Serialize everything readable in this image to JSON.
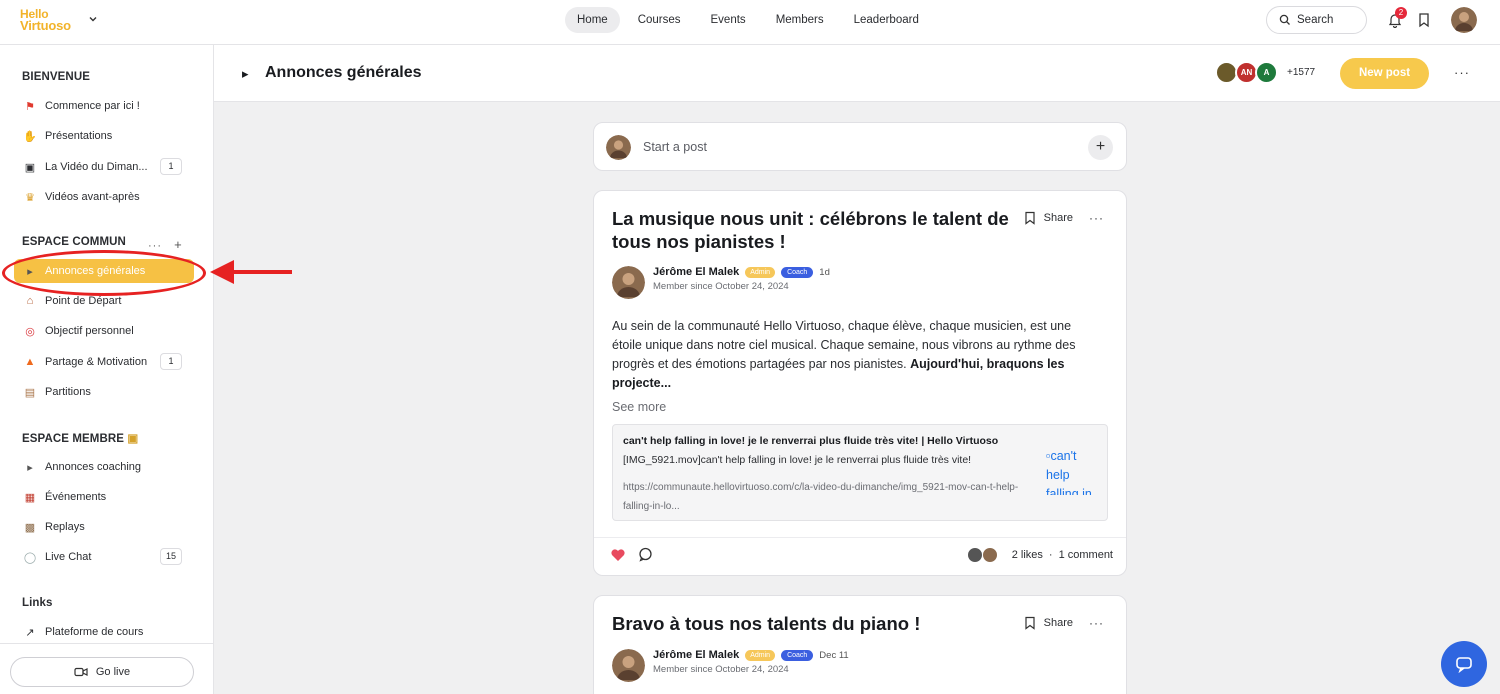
{
  "brand": {
    "line1": "Hello",
    "line2": "Virtuoso"
  },
  "nav": {
    "home": "Home",
    "courses": "Courses",
    "events": "Events",
    "members": "Members",
    "leaderboard": "Leaderboard"
  },
  "search": {
    "label": "Search"
  },
  "notifications": {
    "count": "2"
  },
  "sidebar": {
    "sections": {
      "bienvenue": "BIENVENUE",
      "espace_commun": "ESPACE COMMUN",
      "espace_membre": "ESPACE MEMBRE",
      "links": "Links"
    },
    "bienvenue_items": [
      {
        "icon": "flag-icon",
        "label": "Commence par ici !"
      },
      {
        "icon": "wave-icon",
        "label": "Présentations"
      },
      {
        "icon": "clapper-icon",
        "label": "La Vidéo du Diman...",
        "count": "1"
      },
      {
        "icon": "trophy-icon",
        "label": "Vidéos avant-après"
      }
    ],
    "commun_items": [
      {
        "icon": "megaphone-icon",
        "label": "Annonces générales"
      },
      {
        "icon": "house-icon",
        "label": "Point de Départ"
      },
      {
        "icon": "target-icon",
        "label": "Objectif personnel"
      },
      {
        "icon": "fire-icon",
        "label": "Partage & Motivation",
        "count": "1"
      },
      {
        "icon": "scroll-icon",
        "label": "Partitions"
      }
    ],
    "membre_items": [
      {
        "icon": "megaphone-icon",
        "label": "Annonces coaching"
      },
      {
        "icon": "calendar-icon",
        "label": "Événements"
      },
      {
        "icon": "film-icon",
        "label": "Replays"
      },
      {
        "icon": "speech-icon",
        "label": "Live Chat",
        "count": "15"
      }
    ],
    "links_items": [
      {
        "icon": "arrow-up-right-icon",
        "label": "Plateforme de cours"
      }
    ],
    "go_live": "Go live"
  },
  "space": {
    "title": "Annonces générales",
    "member_avatars": [
      "",
      "AN",
      "A"
    ],
    "member_count": "+1577",
    "new_post": "New post"
  },
  "composer": {
    "placeholder": "Start a post"
  },
  "posts": [
    {
      "title": "La musique nous unit : célébrons le talent de tous nos pianistes !",
      "share": "Share",
      "author": "Jérôme El Malek",
      "admin_tag": "Admin",
      "coach_tag": "Coach",
      "when": "1d",
      "member_since": "Member since October 24, 2024",
      "body": "Au sein de la communauté Hello Virtuoso, chaque élève, chaque musicien, est une étoile unique dans notre ciel musical. Chaque semaine, nous vibrons au rythme des progrès et des émotions partagées par nos pianistes. ",
      "body_bold": "Aujourd'hui, braquons les projecte...",
      "see_more": "See more",
      "link_preview": {
        "title": "can't help falling in love! je le renverrai plus fluide très vite! | Hello Virtuoso",
        "description": "[IMG_5921.mov]can't help falling in love! je le renverrai plus fluide très vite!",
        "url": "https://communaute.hellovirtuoso.com/c/la-video-du-dimanche/img_5921-mov-can-t-help-falling-in-lo...",
        "image_alt": "can't help falling in lo"
      },
      "likes": "2 likes",
      "comments": "1 comment"
    },
    {
      "title": "Bravo à tous nos talents du piano !",
      "share": "Share",
      "author": "Jérôme El Malek",
      "admin_tag": "Admin",
      "coach_tag": "Coach",
      "when": "Dec 11",
      "member_since": "Member since October 24, 2024"
    }
  ],
  "colors": {
    "accent": "#f6c144",
    "annotation": "#e62222",
    "coach": "#3b5fe0",
    "chat": "#2f66e0"
  }
}
